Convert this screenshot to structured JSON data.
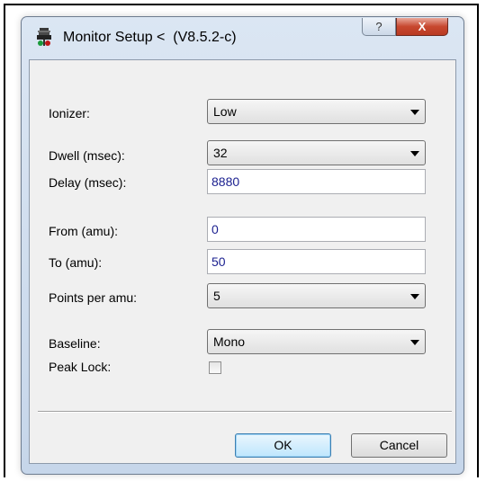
{
  "window": {
    "title": "Monitor Setup <  (V8.5.2-c)",
    "help_glyph": "?",
    "close_glyph": "X",
    "icon": "app-icon"
  },
  "form": {
    "ionizer": {
      "label": "Ionizer:",
      "value": "Low"
    },
    "dwell": {
      "label": "Dwell (msec):",
      "value": "32"
    },
    "delay": {
      "label": "Delay (msec):",
      "value": "8880"
    },
    "from": {
      "label": "From (amu):",
      "value": "0"
    },
    "to": {
      "label": "To (amu):",
      "value": "50"
    },
    "points": {
      "label": "Points per amu:",
      "value": "5"
    },
    "baseline": {
      "label": "Baseline:",
      "value": "Mono"
    },
    "peak_lock": {
      "label": "Peak Lock:",
      "checked": false
    }
  },
  "buttons": {
    "ok": "OK",
    "cancel": "Cancel"
  },
  "colors": {
    "title_close": "#c7482f",
    "input_text": "#1a1f8f",
    "client_bg": "#f0f0f0",
    "frame_bg": "#c6d6ea"
  }
}
